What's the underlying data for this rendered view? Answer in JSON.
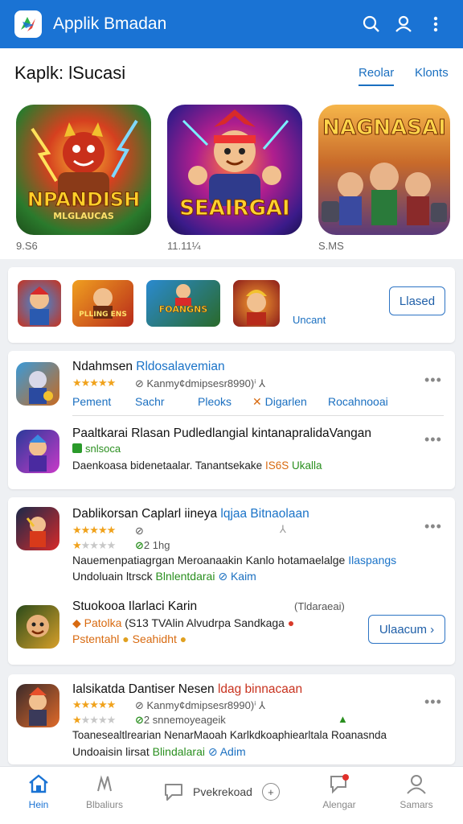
{
  "appbar": {
    "title": "Applik Bmadan",
    "logo_icon": "app-logo-icon",
    "icons": [
      "search-icon",
      "account-icon",
      "more-vert-icon"
    ],
    "brand_color": "#1a73d4"
  },
  "featured": {
    "heading": "Kaplk: lSucasi",
    "tabs": [
      {
        "label": "Reolar",
        "active": true
      },
      {
        "label": "Klonts",
        "active": false
      }
    ],
    "cards": [
      {
        "title": "NPANDISH",
        "subtitle": "MLGLAUCAS",
        "caption": "9.S6"
      },
      {
        "title": "SEAIRGAI",
        "caption": "11.11¼"
      },
      {
        "title": "NAGNASAI",
        "caption": "S.MS"
      }
    ]
  },
  "strip": {
    "thumbs": [
      "",
      "PLLING ENS",
      "FOANGNS",
      ""
    ],
    "label": "Uncant",
    "button": "Llased"
  },
  "section1": {
    "row1": {
      "title": "Ndahmsen",
      "title_accent": "Rldosalavemian",
      "stars": "★★★★★",
      "meta": "⊘ Kanmy¢dmipsesr8990)ⁱ ⅄",
      "links": [
        "Pement",
        "Sachr",
        "Pleoks",
        "Digarlen",
        "Rocahnooai"
      ]
    },
    "row2": {
      "title": "Paaltkarai Rlasan Pudledlangial kintanapralidaVangan",
      "badge": "snlsoca",
      "desc": "Daenkoasa bidenetaalar. Tanantsekake",
      "desc_orange": "IS6S",
      "desc_green": "Ukalla"
    }
  },
  "section2": {
    "row1": {
      "title": "Dablikorsan Caplarl iineya",
      "title_accent": "lqjaa Bitnaolaan",
      "stars": "★★★★★",
      "meta1": "⊘",
      "meta2": "2 1hg",
      "desc1": "Nauemenpatiagrgan Meroanaakin Kanlo hotamaelalge",
      "desc1_accent": "Ilaspangs",
      "desc2": "Undoluain ltrsck",
      "desc2_green": "Blnlentdarai",
      "desc2_tail": "⊘ Kaim"
    },
    "row2": {
      "title": "Stuokooa Ilarlaci Karin",
      "title_right": "(Tldaraeai)",
      "line1_orange": "Patolka",
      "line1": "(S13 TVAlin Alvudrpa Sandkaga",
      "line2_orange": "Pstentahl",
      "line2": "Seahidht",
      "button": "Ulaacum ›"
    }
  },
  "section3": {
    "row1": {
      "title": "Ialsikatda Dantiser Nesen",
      "title_accent": "ldag binnacaan",
      "stars": "★★★★★",
      "meta1": "⊘ Kanmy¢dmipsesr8990)ⁱ ⅄",
      "meta2": "2 snnemoyeageik",
      "desc1": "Toanesealtlrearian NenarMaoah Karlkdkoaphiearltala Roanasnda",
      "desc2": "Undoaisin lirsat",
      "desc2_green": "Blindalarai",
      "desc2_tail": "⊘ Adim"
    }
  },
  "bottomnav": [
    {
      "label": "Hein",
      "icon": "home-icon",
      "active": true
    },
    {
      "label": "Blbaliurs",
      "icon": "explore-icon",
      "active": false
    },
    {
      "label": "Pvekrekoad",
      "icon": "chat-icon",
      "active": false
    },
    {
      "label": "Alengar",
      "icon": "notification-icon",
      "active": false
    },
    {
      "label": "Samars",
      "icon": "profile-icon",
      "active": false
    }
  ]
}
